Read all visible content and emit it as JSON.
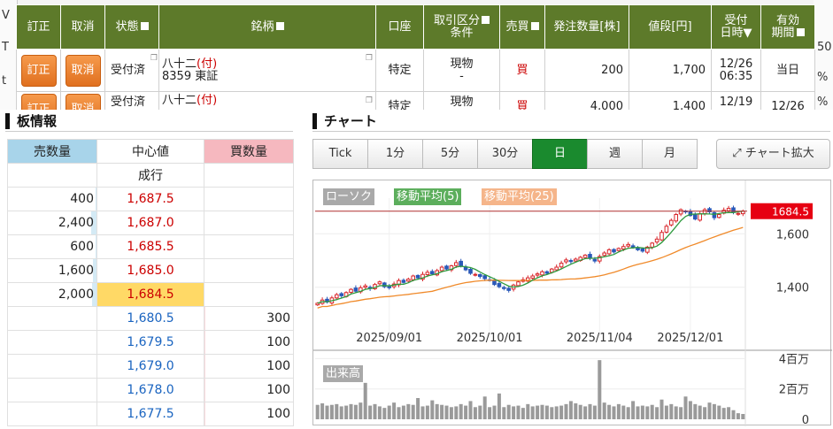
{
  "orders": {
    "bg_left_letters": [
      "V",
      "T",
      "t"
    ],
    "bg_right_fragments": [
      "50",
      "%",
      "%"
    ],
    "headers": {
      "teisei": "訂正",
      "torikeshi": "取消",
      "jotai": "状態",
      "meigara": "銘柄",
      "koza": "口座",
      "torihiki_line1": "取引区分",
      "torihiki_line2": "条件",
      "baibai": "売買",
      "suryo": "発注数量[株]",
      "nedan": "値段[円]",
      "uketsuke_line1": "受付",
      "uketsuke_line2": "日時▼",
      "yuko_line1": "有効",
      "yuko_line2": "期間"
    },
    "rows": [
      {
        "teisei": "訂正",
        "torikeshi": "取消",
        "status": "受付済",
        "name": "八十二",
        "tag": "(付)",
        "code_market": "8359 東証",
        "account": "特定",
        "type": "現物",
        "cond": "-",
        "side": "買",
        "qty": "200",
        "price": "1,700",
        "date": "12/26",
        "time": "06:35",
        "expiry": "当日"
      },
      {
        "teisei": "訂正",
        "torikeshi": "取消",
        "status": "受付済",
        "name": "八十二",
        "tag": "(付)",
        "code_market": "",
        "account": "特定",
        "type": "現物",
        "cond": "",
        "side": "買",
        "qty": "4,000",
        "price": "1,400",
        "date": "12/19",
        "time": "",
        "expiry": "12/26"
      }
    ]
  },
  "board": {
    "title": "板情報",
    "headers": {
      "sell": "売数量",
      "mid": "中心値",
      "buy": "買数量"
    },
    "market_order_label": "成行",
    "max_qty": 2400,
    "asks": [
      {
        "qty": "400",
        "qty_value": 400,
        "price": "1,687.5"
      },
      {
        "qty": "2,400",
        "qty_value": 2400,
        "price": "1,687.0"
      },
      {
        "qty": "600",
        "qty_value": 600,
        "price": "1,685.5"
      },
      {
        "qty": "1,600",
        "qty_value": 1600,
        "price": "1,685.0"
      },
      {
        "qty": "2,000",
        "qty_value": 2000,
        "price": "1,684.5",
        "current": true
      }
    ],
    "bids": [
      {
        "qty": "300",
        "qty_value": 300,
        "price": "1,680.5"
      },
      {
        "qty": "100",
        "qty_value": 100,
        "price": "1,679.5"
      },
      {
        "qty": "100",
        "qty_value": 100,
        "price": "1,679.0"
      },
      {
        "qty": "100",
        "qty_value": 100,
        "price": "1,678.0"
      },
      {
        "qty": "100",
        "qty_value": 100,
        "price": "1,677.5"
      }
    ]
  },
  "chart": {
    "title": "チャート",
    "tabs": [
      "Tick",
      "1分",
      "5分",
      "30分",
      "日",
      "週",
      "月"
    ],
    "active_tab": "日",
    "expand_label": "チャート拡大",
    "legend": {
      "candle": "ローソク",
      "ma5": "移動平均(5)",
      "ma25": "移動平均(25)"
    },
    "current_price_label": "1684.5",
    "volume_label": "出来高",
    "colors": {
      "up": "#d9262b",
      "down": "#2a59b8",
      "ma5": "#2e9a3e",
      "ma25": "#f08a2a",
      "current_line": "#b03030",
      "price_tag": "#e60012"
    }
  },
  "chart_data": {
    "type": "candlestick",
    "y_ticks": [
      "1,600",
      "1,400"
    ],
    "y_tick_values": [
      1600,
      1400
    ],
    "price_range": [
      1270,
      1720
    ],
    "current_price": 1684.5,
    "x_tick_labels": [
      "2025/09/01",
      "2025/10/01",
      "2025/11/04",
      "2025/12/01"
    ],
    "x_tick_index": [
      15,
      36,
      59,
      78
    ],
    "closes": [
      1340,
      1352,
      1345,
      1360,
      1372,
      1368,
      1380,
      1392,
      1385,
      1398,
      1405,
      1395,
      1410,
      1420,
      1402,
      1398,
      1412,
      1425,
      1418,
      1430,
      1442,
      1435,
      1448,
      1456,
      1450,
      1462,
      1475,
      1468,
      1480,
      1492,
      1478,
      1465,
      1452,
      1448,
      1440,
      1432,
      1425,
      1410,
      1402,
      1395,
      1388,
      1408,
      1420,
      1428,
      1435,
      1442,
      1450,
      1458,
      1452,
      1468,
      1475,
      1490,
      1502,
      1496,
      1505,
      1512,
      1520,
      1508,
      1498,
      1515,
      1528,
      1540,
      1532,
      1545,
      1552,
      1560,
      1548,
      1540,
      1535,
      1550,
      1565,
      1580,
      1605,
      1628,
      1650,
      1672,
      1690,
      1684,
      1668,
      1655,
      1675,
      1690,
      1682,
      1660,
      1672,
      1688,
      1695,
      1680,
      1676,
      1684.5
    ],
    "volume_axis_labels": [
      "4百万",
      "2百万",
      "0"
    ],
    "volume_axis_values": [
      4,
      2,
      0
    ],
    "volume_range": [
      0,
      4.2
    ],
    "volumes_millions": [
      0.95,
      1.05,
      0.9,
      0.95,
      1.0,
      0.85,
      0.9,
      1.0,
      0.95,
      1.1,
      2.4,
      0.9,
      1.0,
      0.85,
      0.75,
      0.9,
      1.1,
      0.8,
      0.9,
      1.0,
      0.95,
      1.4,
      0.85,
      0.9,
      1.25,
      1.0,
      0.95,
      0.9,
      0.8,
      0.85,
      1.0,
      0.9,
      1.2,
      0.8,
      0.9,
      1.5,
      0.8,
      0.9,
      1.7,
      0.8,
      0.95,
      0.85,
      0.9,
      0.75,
      1.0,
      0.85,
      0.9,
      0.95,
      0.9,
      0.8,
      0.85,
      0.9,
      1.0,
      1.2,
      1.05,
      0.95,
      0.85,
      1.0,
      0.9,
      3.9,
      1.1,
      0.95,
      0.85,
      1.0,
      0.9,
      0.8,
      1.2,
      0.85,
      0.9,
      0.85,
      0.95,
      0.8,
      1.3,
      0.9,
      1.0,
      0.85,
      0.8,
      1.5,
      1.2,
      1.0,
      0.9,
      0.8,
      1.1,
      1.0,
      0.9,
      0.75,
      0.8,
      0.6,
      0.4,
      0.35
    ]
  }
}
